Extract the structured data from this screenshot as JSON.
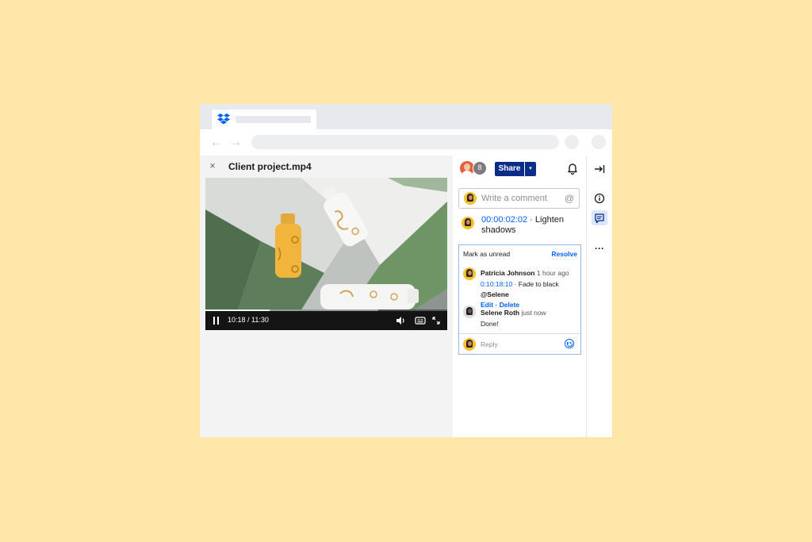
{
  "browser": {
    "tab_title": "",
    "address": ""
  },
  "file": {
    "close_label": "×",
    "title": "Client project.mp4"
  },
  "video": {
    "time_display": "10:18 / 11:30",
    "progress": 0.264
  },
  "header": {
    "collaborator_count": "8",
    "share_label": "Share",
    "share_caret": "▾"
  },
  "comment_box": {
    "placeholder": "Write a comment",
    "mention_symbol": "@"
  },
  "pinned_comment": {
    "timestamp": "00:00:02:02",
    "separator": " · ",
    "text": "Lighten shadows"
  },
  "thread": {
    "mark_unread": "Mark as unread",
    "resolve": "Resolve",
    "comment1": {
      "author": "Patricia Johnson",
      "time": "1 hour ago",
      "timestamp": "0:10:18:10",
      "separator": " · ",
      "text": "Fade to black",
      "mention": "@Selene"
    },
    "actions": {
      "edit": "Edit",
      "separator": " · ",
      "delete": "Delete"
    },
    "comment2": {
      "author": "Selene Roth",
      "time": "just now",
      "text": "Done!"
    },
    "reply_placeholder": "Reply"
  },
  "rail": {
    "more": "···"
  },
  "colors": {
    "background": "#fde6a8",
    "brand_blue": "#0061fe",
    "share_navy": "#0b2d8a"
  }
}
